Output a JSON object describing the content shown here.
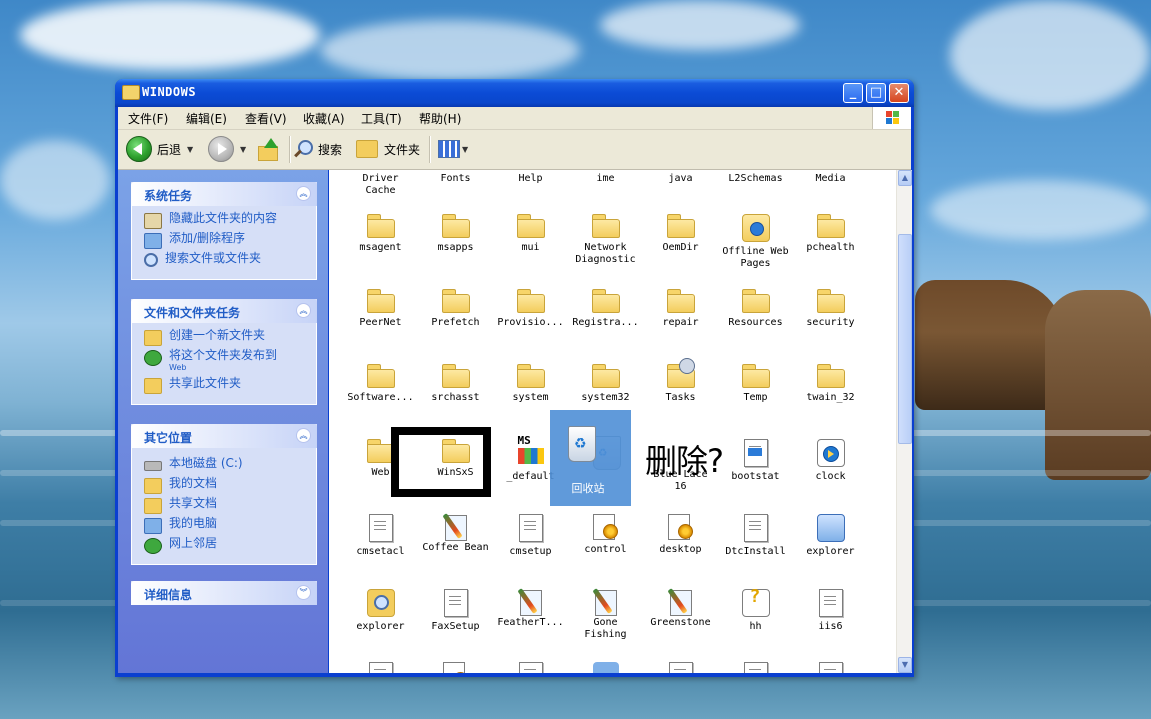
{
  "window": {
    "title": "WINDOWS",
    "minimize": "_",
    "maximize": "□",
    "close": "✕"
  },
  "menu": {
    "items": [
      "文件(F)",
      "编辑(E)",
      "查看(V)",
      "收藏(A)",
      "工具(T)",
      "帮助(H)"
    ]
  },
  "toolbar": {
    "back_label": "后退",
    "search_label": "搜索",
    "folders_label": "文件夹"
  },
  "tasks": {
    "system": {
      "title": "系统任务",
      "items": [
        "隐藏此文件夹的内容",
        "添加/删除程序",
        "搜索文件或文件夹"
      ]
    },
    "file_folder": {
      "title": "文件和文件夹任务",
      "items": [
        "创建一个新文件夹",
        "将这个文件夹发布到",
        "Web",
        "共享此文件夹"
      ]
    },
    "other_places": {
      "title": "其它位置",
      "items": [
        "本地磁盘 (C:)",
        "我的文档",
        "共享文档",
        "我的电脑",
        "网上邻居"
      ]
    },
    "details": {
      "title": "详细信息"
    }
  },
  "files": {
    "row0": [
      "Driver\nCache",
      "Fonts",
      "Help",
      "ime",
      "java",
      "L2Schemas",
      "Media"
    ],
    "row1": [
      "msagent",
      "msapps",
      "mui",
      "Network\nDiagnostic",
      "OemDir",
      "Offline Web\nPages",
      "pchealth"
    ],
    "row2": [
      "PeerNet",
      "Prefetch",
      "Provisio...",
      "Registra...",
      "repair",
      "Resources",
      "security"
    ],
    "row3": [
      "Software...",
      "srchasst",
      "system",
      "system32",
      "Tasks",
      "Temp",
      "twain_32"
    ],
    "row4": [
      "Web",
      "WinSxS",
      "_default",
      "回收站",
      "Blue Lace\n16",
      "bootstat",
      "clock"
    ],
    "row5": [
      "cmsetacl",
      "Coffee Bean",
      "cmsetup",
      "control",
      "desktop",
      "DtcInstall",
      "explorer"
    ],
    "row6": [
      "explorer",
      "FaxSetup",
      "FeatherT...",
      "Gone\nFishing",
      "Greenstone",
      "hh",
      "iis6"
    ]
  },
  "overlay": {
    "delete_text": "删除?"
  },
  "colors": {
    "title_blue": "#0a47cc",
    "task_link": "#215dc6",
    "folder_yellow": "#f3cd5d",
    "selection": "#4f8fd6"
  }
}
